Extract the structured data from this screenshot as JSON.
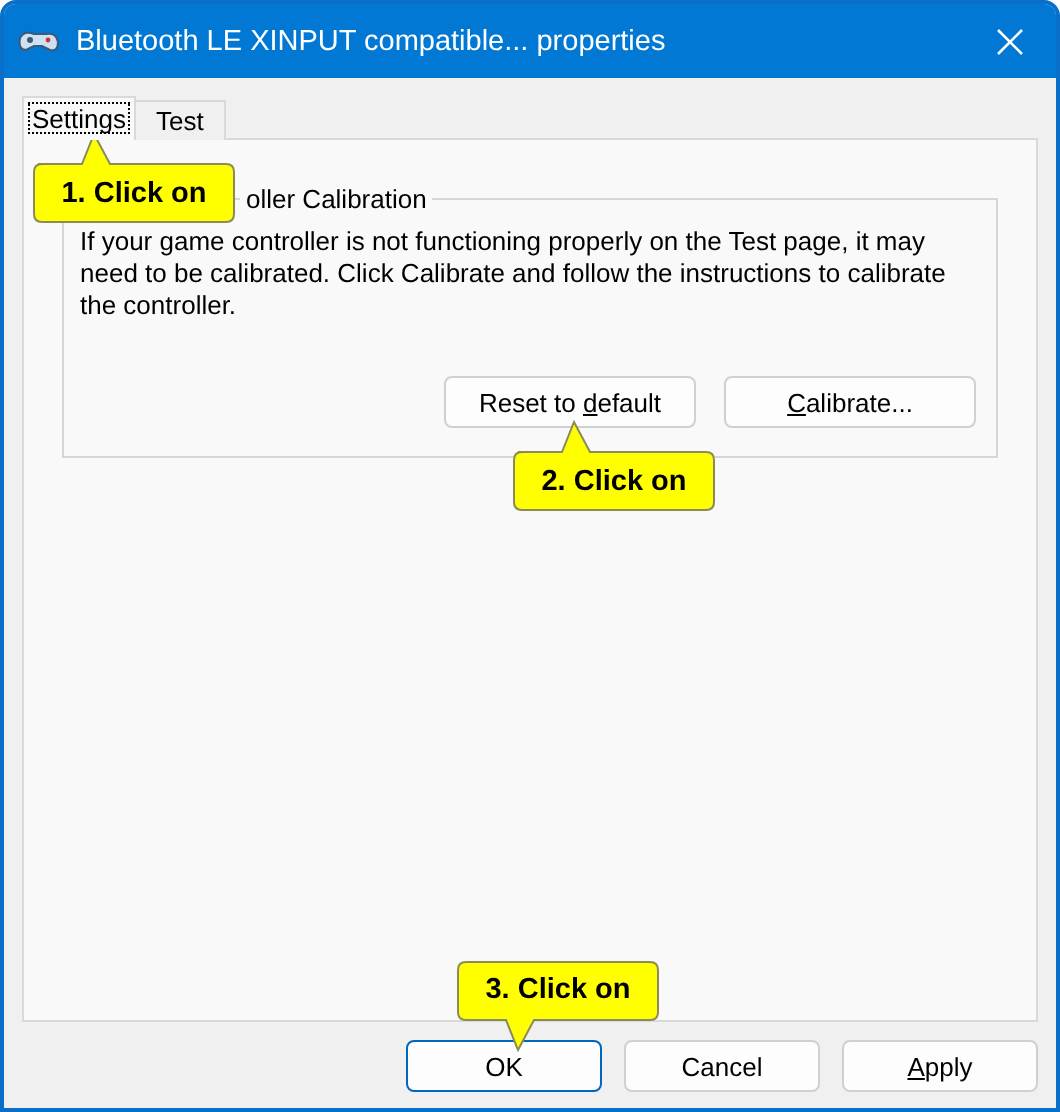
{
  "window": {
    "title": "Bluetooth LE XINPUT compatible... properties"
  },
  "tabs": [
    {
      "label": "Settings",
      "selected": true
    },
    {
      "label": "Test",
      "selected": false
    }
  ],
  "group": {
    "label": "oller Calibration",
    "text": "If your game controller is not functioning properly on the Test page, it may need to be calibrated.  Click Calibrate and follow the instructions to calibrate the controller.",
    "buttons": [
      {
        "before": "Reset to ",
        "key": "d",
        "after": "efault"
      },
      {
        "key": "C",
        "after": "alibrate..."
      }
    ]
  },
  "dialog_buttons": [
    {
      "before": "OK",
      "default": true
    },
    {
      "before": "Cancel",
      "default": false
    },
    {
      "key": "A",
      "after": "pply",
      "default": false
    }
  ],
  "callouts": [
    {
      "text": "1. Click on",
      "kind": "up"
    },
    {
      "text": "2. Click on",
      "kind": "up"
    },
    {
      "text": "3. Click on",
      "kind": "down"
    }
  ]
}
